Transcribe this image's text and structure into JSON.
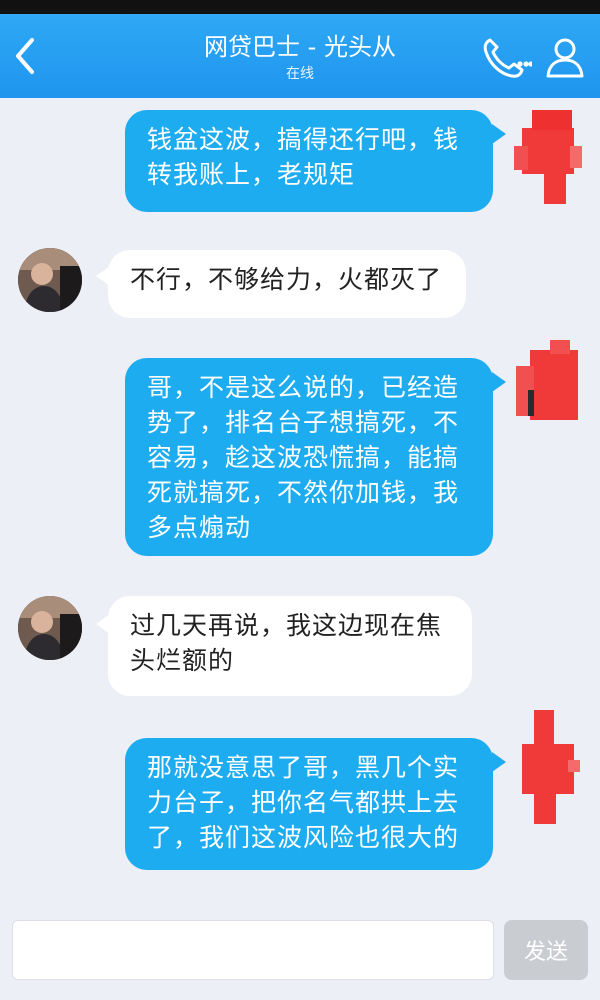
{
  "header": {
    "title": "网贷巴士 - 光头从",
    "status": "在线",
    "back_icon": "chevron-left-icon",
    "phone_icon": "phone-icon",
    "contact_icon": "contact-icon"
  },
  "messages": [
    {
      "direction": "outgoing",
      "text": "钱盆这波，搞得还行吧，钱转我账上，老规矩"
    },
    {
      "direction": "incoming",
      "text": "不行，不够给力，火都灭了"
    },
    {
      "direction": "outgoing",
      "text": "哥，不是这么说的，已经造势了，排名台子想搞死，不容易，趁这波恐慌搞，能搞死就搞死，不然你加钱，我多点煽动"
    },
    {
      "direction": "incoming",
      "text": "过几天再说，我这边现在焦头烂额的"
    },
    {
      "direction": "outgoing",
      "text": "那就没意思了哥，黑几个实力台子，把你名气都拱上去了，我们这波风险也很大的"
    }
  ],
  "composer": {
    "input_value": "",
    "send_label": "发送"
  },
  "colors": {
    "header": "#1e95ee",
    "outgoing_bubble": "#1eacf1",
    "incoming_bubble": "#ffffff",
    "background": "#eceff5",
    "send_disabled": "#c9ccd1"
  }
}
